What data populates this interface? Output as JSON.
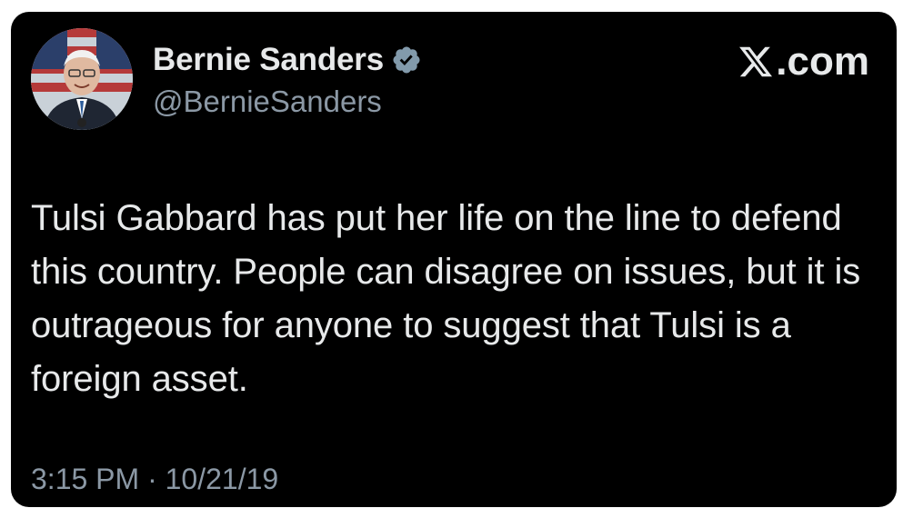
{
  "tweet": {
    "author": {
      "display_name": "Bernie Sanders",
      "handle": "@BernieSanders",
      "verified_icon": "verified-badge-icon",
      "avatar_icon": "profile-avatar"
    },
    "brand": {
      "icon": "x-logo-icon",
      "suffix": ".com"
    },
    "text": "Tulsi Gabbard has put her life on the line to defend this country. People can disagree on issues, but it is outrageous for anyone to suggest that Tulsi is a foreign asset.",
    "timestamp": "3:15 PM · 10/21/19"
  },
  "colors": {
    "card_background": "#000000",
    "primary_text": "#e7e9ea",
    "secondary_text": "#8b98a5",
    "verified_badge": "#829aab"
  }
}
